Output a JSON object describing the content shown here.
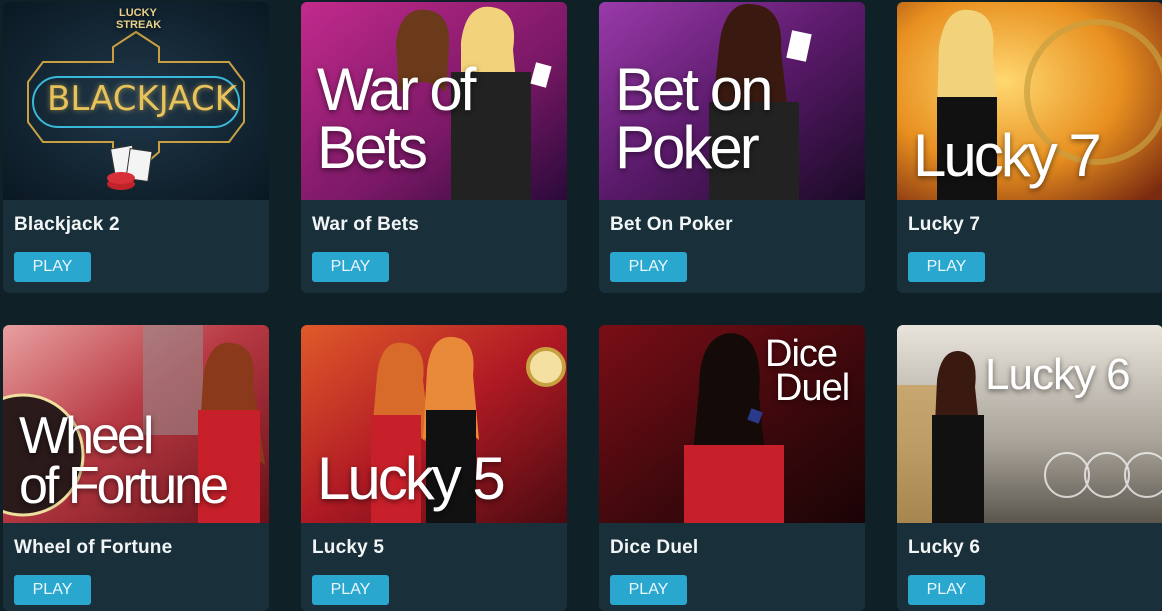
{
  "games": [
    {
      "title": "Blackjack 2",
      "play_label": "PLAY",
      "art": {
        "logo_top": "LUCKY",
        "logo_mid": "STREAK",
        "logo_main": "BLACKJACK",
        "colors": [
          "#0c1c2a",
          "#20384a"
        ]
      }
    },
    {
      "title": "War of Bets",
      "play_label": "PLAY",
      "art": {
        "line1": "War of",
        "line2": "Bets",
        "colors": [
          "#b01a7a",
          "#3a0f4a"
        ]
      }
    },
    {
      "title": "Bet On Poker",
      "play_label": "PLAY",
      "art": {
        "line1": "Bet on",
        "line2": "Poker",
        "colors": [
          "#8a2a9a",
          "#2a0a3a"
        ]
      }
    },
    {
      "title": "Lucky 7",
      "play_label": "PLAY",
      "art": {
        "line1": "Lucky 7",
        "colors": [
          "#f0b030",
          "#a0401a"
        ]
      }
    },
    {
      "title": "Wheel of Fortune",
      "play_label": "PLAY",
      "art": {
        "line1": "Wheel",
        "line2": "of Fortune",
        "colors": [
          "#e58a8a",
          "#8a1a24"
        ]
      }
    },
    {
      "title": "Lucky 5",
      "play_label": "PLAY",
      "art": {
        "line1": "Lucky 5",
        "colors": [
          "#c0242a",
          "#5a1014"
        ]
      }
    },
    {
      "title": "Dice Duel",
      "play_label": "PLAY",
      "art": {
        "line1": "Dice",
        "line2": "Duel",
        "colors": [
          "#6a0c12",
          "#2a0608"
        ]
      }
    },
    {
      "title": "Lucky 6",
      "play_label": "PLAY",
      "art": {
        "line1": "Lucky 6",
        "colors": [
          "#d8d4cc",
          "#8a8478"
        ]
      }
    }
  ],
  "theme": {
    "background": "#0f2027",
    "card": "#19303a",
    "button": "#2aa7cf"
  }
}
